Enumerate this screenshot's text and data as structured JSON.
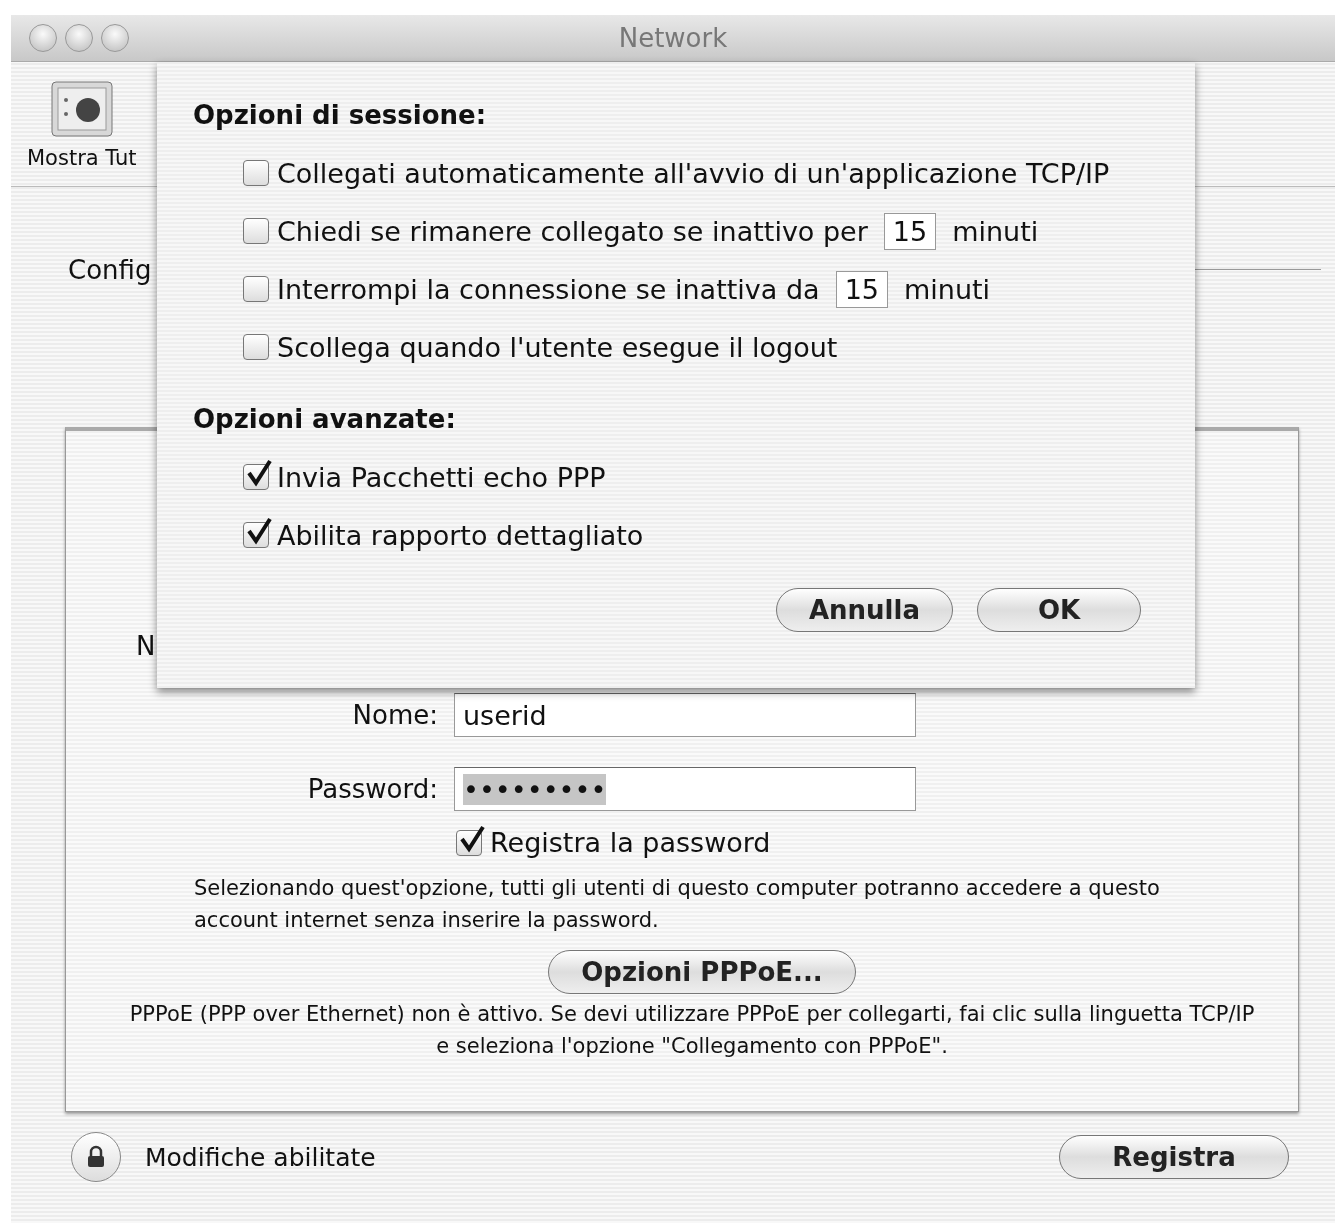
{
  "window": {
    "title": "Network"
  },
  "toolbar": {
    "items": [
      {
        "label": "Mostra Tut"
      }
    ]
  },
  "configure": {
    "label": "Config"
  },
  "panel": {
    "service_label": "N",
    "fields": [
      {
        "kind": "text",
        "label": "Nome:",
        "value": "userid"
      },
      {
        "kind": "password",
        "label": "Password:",
        "value": "•••••••••"
      }
    ],
    "save_password": {
      "label": "Registra la password",
      "checked": true
    },
    "note": "Selezionando quest'opzione, tutti gli utenti di questo computer potranno accedere a questo account internet senza inserire la password.",
    "options_button": "Opzioni PPPoE...",
    "status_note": "PPPoE (PPP over Ethernet) non è attivo. Se devi utilizzare PPPoE per collegarti, fai clic sulla linguetta TCP/IP e seleziona l'opzione \"Collegamento con PPPoE\"."
  },
  "footer": {
    "lock_label": "Modifiche abilitate",
    "save_button": "Registra"
  },
  "sheet": {
    "sections": [
      {
        "title": "Opzioni di sessione:",
        "options": [
          {
            "kind": "check",
            "label": "Collegati automaticamente all'avvio di un'applicazione TCP/IP",
            "checked": false
          },
          {
            "kind": "minutes",
            "label": "Chiedi se rimanere collegato se inattivo per",
            "value": "15",
            "unit": "minuti",
            "checked": false
          },
          {
            "kind": "minutes",
            "label": "Interrompi la connessione se inattiva da",
            "value": "15",
            "unit": "minuti",
            "checked": false
          },
          {
            "kind": "check",
            "label": "Scollega quando l'utente esegue il logout",
            "checked": false
          }
        ]
      },
      {
        "title": "Opzioni avanzate:",
        "options": [
          {
            "kind": "check",
            "label": "Invia Pacchetti echo PPP",
            "checked": true
          },
          {
            "kind": "check",
            "label": "Abilita rapporto dettagliato",
            "checked": true
          }
        ]
      }
    ],
    "buttons": [
      "Annulla",
      "OK"
    ]
  }
}
